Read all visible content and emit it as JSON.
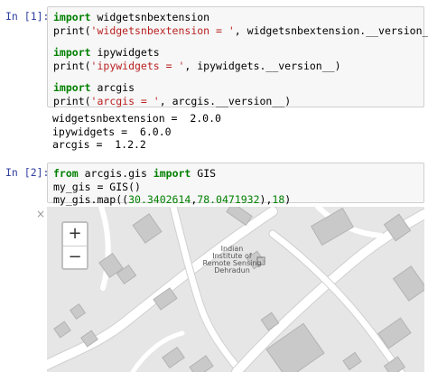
{
  "cells": [
    {
      "prompt": "In [1]:",
      "lines": [
        [
          {
            "t": "import",
            "c": "kw"
          },
          {
            "t": " widgetsnbextension",
            "c": ""
          }
        ],
        [
          {
            "t": "print(",
            "c": ""
          },
          {
            "t": "'widgetsnbextension = '",
            "c": "str"
          },
          {
            "t": ", widgetsnbextension.__version__)",
            "c": ""
          }
        ],
        [],
        [
          {
            "t": "import",
            "c": "kw"
          },
          {
            "t": " ipywidgets",
            "c": ""
          }
        ],
        [
          {
            "t": "print(",
            "c": ""
          },
          {
            "t": "'ipywidgets = '",
            "c": "str"
          },
          {
            "t": ", ipywidgets.__version__)",
            "c": ""
          }
        ],
        [],
        [
          {
            "t": "import",
            "c": "kw"
          },
          {
            "t": " arcgis",
            "c": ""
          }
        ],
        [
          {
            "t": "print(",
            "c": ""
          },
          {
            "t": "'arcgis = '",
            "c": "str"
          },
          {
            "t": ", arcgis.__version__)",
            "c": ""
          }
        ]
      ],
      "output": [
        "widgetsnbextension =  2.0.0",
        "ipywidgets =  6.0.0",
        "arcgis =  1.2.2"
      ]
    },
    {
      "prompt": "In [2]:",
      "lines": [
        [
          {
            "t": "from",
            "c": "kw"
          },
          {
            "t": " arcgis.gis ",
            "c": ""
          },
          {
            "t": "import",
            "c": "kw"
          },
          {
            "t": " GIS",
            "c": ""
          }
        ],
        [
          {
            "t": "my_gis = GIS()",
            "c": ""
          }
        ],
        [
          {
            "t": "my_gis.map((",
            "c": ""
          },
          {
            "t": "30.3402614",
            "c": "num"
          },
          {
            "t": ",",
            "c": ""
          },
          {
            "t": "78.0471932",
            "c": "num"
          },
          {
            "t": "),",
            "c": ""
          },
          {
            "t": "18",
            "c": "num"
          },
          {
            "t": ")",
            "c": ""
          }
        ]
      ]
    }
  ],
  "map": {
    "close_symbol": "×",
    "zoom_in": "+",
    "zoom_out": "−",
    "label_lines": [
      "Indian",
      "Institute of",
      "Remote Sensing",
      "Dehradun"
    ],
    "colors": {
      "background": "#e6e6e6",
      "road": "#ffffff",
      "road_edge": "#cfcfcf",
      "building": "#c9c9c9",
      "building_edge": "#b3b3b3"
    }
  }
}
